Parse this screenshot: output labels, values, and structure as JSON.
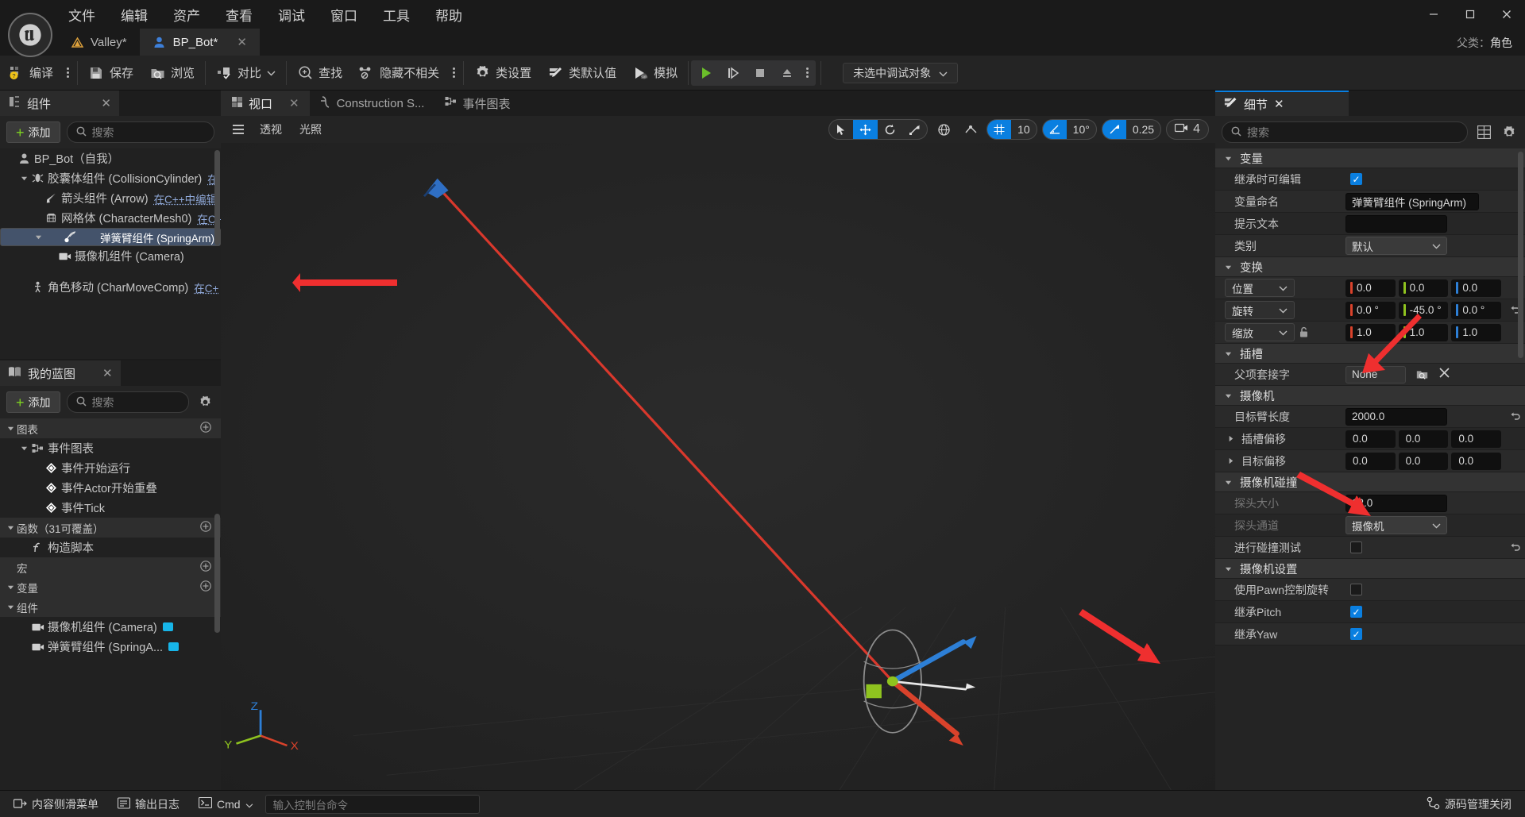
{
  "menu": {
    "items": [
      "文件",
      "编辑",
      "资产",
      "查看",
      "调试",
      "窗口",
      "工具",
      "帮助"
    ]
  },
  "window_controls": {
    "minimize": "—",
    "maximize": "▢",
    "close": "✕"
  },
  "tabs": [
    {
      "label": "Valley*",
      "icon": "mountain-icon",
      "active": false,
      "closable": false
    },
    {
      "label": "BP_Bot*",
      "icon": "blueprint-bot-icon",
      "active": true,
      "closable": true,
      "close": "✕"
    }
  ],
  "parent_class": {
    "label": "父类：",
    "value": "角色"
  },
  "toolbar": {
    "compile": "编译",
    "save": "保存",
    "browse": "浏览",
    "diff": "对比",
    "find": "查找",
    "hide_unrelated": "隐藏不相关",
    "class_settings": "类设置",
    "class_defaults": "类默认值",
    "simulate": "模拟",
    "debug_object": "未选中调试对象"
  },
  "components_panel": {
    "title": "组件",
    "close": "✕",
    "add": "添加",
    "search_placeholder": "搜索",
    "tree": [
      {
        "label": "BP_Bot（自我）",
        "indent": 0,
        "icon": "bot-icon",
        "arrow": "none",
        "selected": false,
        "cpp": ""
      },
      {
        "label": "胶囊体组件 (CollisionCylinder)",
        "indent": 1,
        "icon": "capsule-icon",
        "arrow": "down",
        "selected": false,
        "cpp": "在"
      },
      {
        "label": "箭头组件 (Arrow)",
        "indent": 2,
        "icon": "arrow-comp-icon",
        "arrow": "none",
        "selected": false,
        "cpp": "在C++中编辑"
      },
      {
        "label": "网格体 (CharacterMesh0)",
        "indent": 2,
        "icon": "mesh-icon",
        "arrow": "none",
        "selected": false,
        "cpp": "在C+"
      },
      {
        "label": "弹簧臂组件 (SpringArm)",
        "indent": 2,
        "icon": "springarm-icon",
        "arrow": "down",
        "selected": true,
        "cpp": ""
      },
      {
        "label": "摄像机组件 (Camera)",
        "indent": 3,
        "icon": "camera-icon",
        "arrow": "none",
        "selected": false,
        "cpp": ""
      },
      {
        "label": "角色移动 (CharMoveComp)",
        "indent": 1,
        "icon": "charmove-icon",
        "arrow": "none",
        "selected": false,
        "cpp": "在C+"
      }
    ]
  },
  "myblueprint_panel": {
    "title": "我的蓝图",
    "close": "✕",
    "add": "添加",
    "search_placeholder": "搜索",
    "settings_icon": "gear-icon",
    "sections": [
      {
        "type": "header",
        "label": "图表",
        "arrow": "down",
        "plus": true
      },
      {
        "type": "group",
        "label": "事件图表",
        "arrow": "down",
        "icon": "graph-icon",
        "indent": 1
      },
      {
        "type": "item",
        "label": "事件开始运行",
        "icon": "event-node-icon",
        "indent": 2
      },
      {
        "type": "item",
        "label": "事件Actor开始重叠",
        "icon": "event-node-icon",
        "indent": 2
      },
      {
        "type": "item",
        "label": "事件Tick",
        "icon": "event-node-icon",
        "indent": 2
      },
      {
        "type": "header",
        "label": "函数（31可覆盖）",
        "arrow": "down",
        "plus": true
      },
      {
        "type": "item",
        "label": "构造脚本",
        "icon": "function-icon",
        "indent": 1
      },
      {
        "type": "header",
        "label": "宏",
        "arrow": "none",
        "plus": true,
        "flat": true
      },
      {
        "type": "header",
        "label": "变量",
        "arrow": "down",
        "plus": true
      },
      {
        "type": "header",
        "label": "组件",
        "arrow": "down",
        "plus": false
      },
      {
        "type": "item",
        "label": "摄像机组件 (Camera)",
        "icon": "camera-var-icon",
        "indent": 1,
        "swatch": "#17b5e8"
      },
      {
        "type": "item",
        "label": "弹簧臂组件 (SpringA...",
        "icon": "camera-var-icon",
        "indent": 1,
        "swatch": "#17b5e8"
      }
    ]
  },
  "viewport": {
    "tabs": [
      {
        "label": "视口",
        "icon": "viewport-icon",
        "active": true,
        "close": "✕"
      },
      {
        "label": "Construction S...",
        "icon": "construction-icon",
        "active": false
      },
      {
        "label": "事件图表",
        "icon": "graph-icon",
        "active": false
      }
    ],
    "menu_icon": "hamburger-icon",
    "perspective": "透视",
    "lighting": "光照",
    "tools": {
      "select": "select-cursor-icon",
      "move": "move-gizmo-icon",
      "rotate": "rotate-gizmo-icon",
      "scale": "scale-gizmo-icon",
      "world_coords": "globe-icon",
      "surface_snap": "surface-snap-icon"
    },
    "grid_snap": "10",
    "angle_snap": "10°",
    "scale_snap": "0.25",
    "camera_speed": "4"
  },
  "details_panel": {
    "title": "细节",
    "close": "✕",
    "search_placeholder": "搜索",
    "grid_icon": "grid-view-icon",
    "settings_icon": "gear-icon",
    "categories": [
      {
        "name": "变量",
        "rows": [
          {
            "label": "继承时可编辑",
            "type": "checkbox",
            "checked": true
          },
          {
            "label": "变量命名",
            "type": "text",
            "value": "弹簧臂组件 (SpringArm)",
            "width": "w2"
          },
          {
            "label": "提示文本",
            "type": "text",
            "value": "",
            "width": "w1"
          },
          {
            "label": "类别",
            "type": "select",
            "value": "默认"
          }
        ]
      },
      {
        "name": "变换",
        "rows": [
          {
            "label": "",
            "type": "vector",
            "axis_label": "位置",
            "values": [
              "0.0",
              "0.0",
              "0.0"
            ],
            "reset": false,
            "lock": false
          },
          {
            "label": "",
            "type": "vector",
            "axis_label": "旋转",
            "values": [
              "0.0 °",
              "-45.0 °",
              "0.0 °"
            ],
            "reset": true,
            "lock": false
          },
          {
            "label": "",
            "type": "vector",
            "axis_label": "缩放",
            "values": [
              "1.0",
              "1.0",
              "1.0"
            ],
            "reset": false,
            "lock": true
          }
        ]
      },
      {
        "name": "插槽",
        "rows": [
          {
            "label": "父项套接字",
            "type": "socket",
            "value": "None",
            "browse_icon": "browse-folder-icon",
            "clear_icon": "close-icon"
          }
        ]
      },
      {
        "name": "摄像机",
        "rows": [
          {
            "label": "目标臂长度",
            "type": "text",
            "value": "2000.0",
            "width": "wide",
            "reset": true
          },
          {
            "label": "插槽偏移",
            "type": "vector3",
            "expandable": true,
            "values": [
              "0.0",
              "0.0",
              "0.0"
            ]
          },
          {
            "label": "目标偏移",
            "type": "vector3",
            "expandable": true,
            "values": [
              "0.0",
              "0.0",
              "0.0"
            ]
          }
        ]
      },
      {
        "name": "摄像机碰撞",
        "rows": [
          {
            "label": "探头大小",
            "type": "text",
            "value": "12.0",
            "width": "wide",
            "dim": true
          },
          {
            "label": "探头通道",
            "type": "select",
            "value": "摄像机",
            "dim": true
          },
          {
            "label": "进行碰撞测试",
            "type": "checkbox",
            "checked": false,
            "reset": true
          }
        ]
      },
      {
        "name": "摄像机设置",
        "rows": [
          {
            "label": "使用Pawn控制旋转",
            "type": "checkbox",
            "checked": false
          },
          {
            "label": "继承Pitch",
            "type": "checkbox",
            "checked": true
          },
          {
            "label": "继承Yaw",
            "type": "checkbox",
            "checked": true
          }
        ]
      }
    ]
  },
  "statusbar": {
    "content_drawer": "内容侧滑菜单",
    "output_log": "输出日志",
    "cmd_label": "Cmd",
    "cmd_placeholder": "输入控制台命令",
    "source_control": "源码管理关闭"
  },
  "colors": {
    "accent_blue": "#0a7fe0",
    "selection_blue": "#44536b",
    "axis_x": "#d9422b",
    "axis_y": "#8fc31f",
    "axis_z": "#2d7fd6",
    "green_play": "#6bbf2a",
    "annotation_red": "#ef2f2f",
    "green_plus": "#7ed321"
  }
}
